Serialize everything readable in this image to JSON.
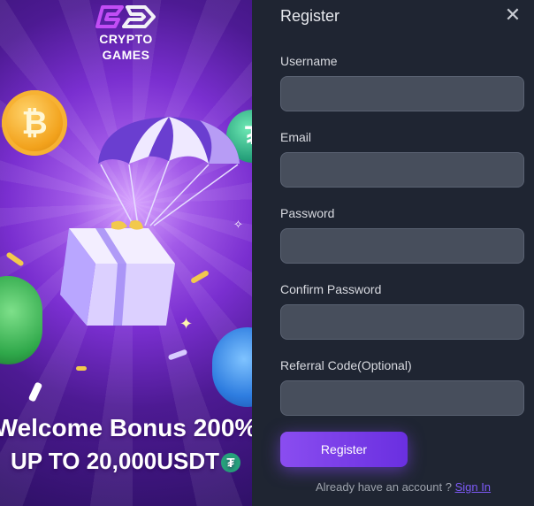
{
  "promo": {
    "brand_line1": "CRYPTO",
    "brand_line2": "GAMES",
    "headline": "Welcome Bonus 200%",
    "subline": "UP TO 20,000USDT",
    "btc_symbol": "₿",
    "usdt_symbol": "₮",
    "accent_colors": {
      "bg_purple": "#7a2fd0",
      "btc_gold": "#f2a21c",
      "usdt_green": "#26a17b"
    }
  },
  "form": {
    "title": "Register",
    "close_symbol": "✕",
    "fields": [
      {
        "label": "Username",
        "value": "",
        "placeholder": ""
      },
      {
        "label": "Email",
        "value": "",
        "placeholder": ""
      },
      {
        "label": "Password",
        "value": "",
        "placeholder": ""
      },
      {
        "label": "Confirm Password",
        "value": "",
        "placeholder": ""
      },
      {
        "label": "Referral Code(Optional)",
        "value": "",
        "placeholder": ""
      }
    ],
    "submit_label": "Register",
    "account_prompt": "Already have an account ?",
    "signin_label": "Sign In",
    "accent_color": "#7d5af7"
  }
}
